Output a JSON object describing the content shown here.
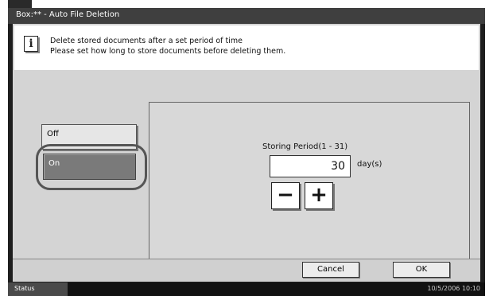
{
  "titlebar": {
    "title": "Box:** - Auto File Deletion"
  },
  "info": {
    "icon": "info-icon",
    "line1": "Delete stored documents after a set period of time",
    "line2": "Please set how long to store documents before deleting them."
  },
  "options": {
    "off_label": "Off",
    "on_label": "On",
    "selected": "On"
  },
  "storing_period": {
    "label": "Storing Period(1 - 31)",
    "value": "30",
    "unit": "day(s)",
    "minus": "−",
    "plus": "+"
  },
  "footer": {
    "cancel_label": "Cancel",
    "ok_label": "OK"
  },
  "statusbar": {
    "status_label": "Status",
    "datetime": "10/5/2006   10:10"
  }
}
